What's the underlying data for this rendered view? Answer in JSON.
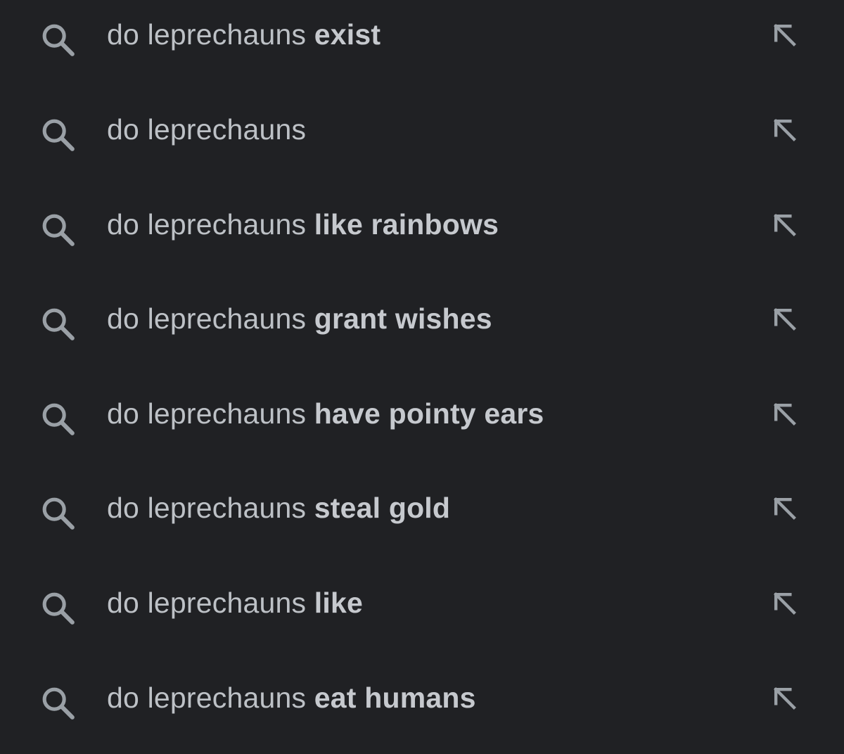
{
  "colors": {
    "background": "#202124",
    "text": "#bdc1c6",
    "icon": "#9aa0a6"
  },
  "suggestions": [
    {
      "query": "do leprechauns",
      "completion": "exist",
      "icon": "search-icon",
      "action_icon": "arrow-up-left-icon"
    },
    {
      "query": "do leprechauns",
      "completion": "",
      "icon": "search-icon",
      "action_icon": "arrow-up-left-icon"
    },
    {
      "query": "do leprechauns",
      "completion": "like rainbows",
      "icon": "search-icon",
      "action_icon": "arrow-up-left-icon"
    },
    {
      "query": "do leprechauns",
      "completion": "grant wishes",
      "icon": "search-icon",
      "action_icon": "arrow-up-left-icon"
    },
    {
      "query": "do leprechauns",
      "completion": "have pointy ears",
      "icon": "search-icon",
      "action_icon": "arrow-up-left-icon"
    },
    {
      "query": "do leprechauns",
      "completion": "steal gold",
      "icon": "search-icon",
      "action_icon": "arrow-up-left-icon"
    },
    {
      "query": "do leprechauns",
      "completion": "like",
      "icon": "search-icon",
      "action_icon": "arrow-up-left-icon"
    },
    {
      "query": "do leprechauns",
      "completion": "eat humans",
      "icon": "search-icon",
      "action_icon": "arrow-up-left-icon"
    }
  ]
}
